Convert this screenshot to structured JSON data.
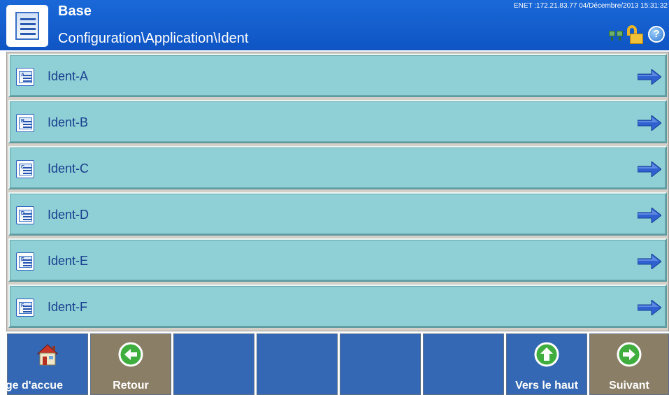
{
  "header": {
    "title": "Base",
    "path": "Configuration\\Application\\Ident",
    "status": "ENET :172.21.83.77  04/Décembre/2013 15:31:32",
    "icons": [
      "document-icon",
      "network-icon",
      "unlock-icon",
      "help-icon"
    ],
    "help_glyph": "?"
  },
  "list": {
    "items": [
      {
        "label": "Ident-A",
        "letter": "A"
      },
      {
        "label": "Ident-B",
        "letter": "B"
      },
      {
        "label": "Ident-C",
        "letter": "C"
      },
      {
        "label": "Ident-D",
        "letter": "D"
      },
      {
        "label": "Ident-E",
        "letter": "E"
      },
      {
        "label": "Ident-F",
        "letter": "F"
      }
    ]
  },
  "softkeys": {
    "home": "age d'accue",
    "back": "Retour",
    "top": "Vers le haut",
    "next": "Suivant"
  },
  "colors": {
    "header": "#1560cf",
    "list_item": "#8ed0d5",
    "softkey_blue": "#3468b4",
    "softkey_tan": "#8b7e66",
    "arrow": "#2f62d0"
  }
}
